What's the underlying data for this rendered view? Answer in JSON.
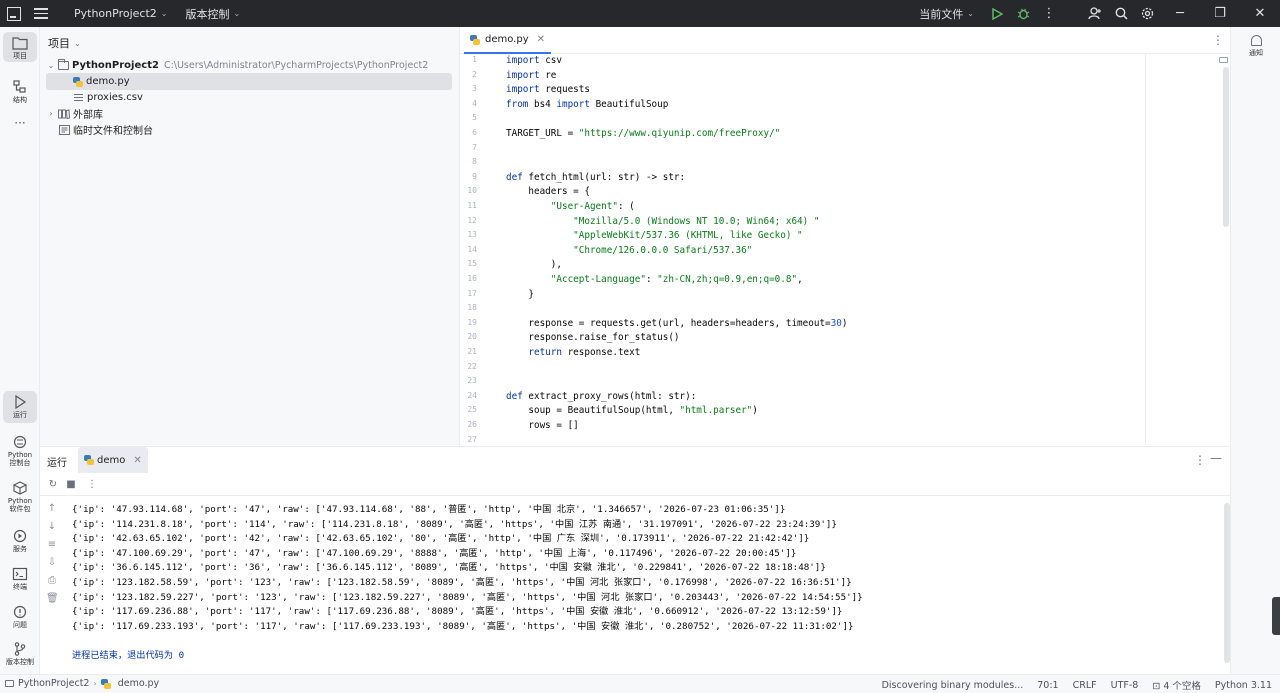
{
  "titlebar": {
    "project": "PythonProject2",
    "vcs": "版本控制",
    "run_config": "当前文件"
  },
  "leftbar": {
    "project_label": "项目",
    "structure_label": "结构",
    "run_label": "运行",
    "python_console_label_1": "Python",
    "python_console_label_2": "控制台",
    "python_packages_label_1": "Python",
    "python_packages_label_2": "软件包",
    "services_label": "服务",
    "terminal_label": "终端",
    "problems_label": "问题",
    "vcs_label": "版本控制"
  },
  "project_panel": {
    "title": "项目",
    "root_name": "PythonProject2",
    "root_path": "C:\\Users\\Administrator\\PycharmProjects\\PythonProject2",
    "file1": "demo.py",
    "file2": "proxies.csv",
    "external_libs": "外部库",
    "scratches": "临时文件和控制台"
  },
  "editor": {
    "tab": "demo.py",
    "lines": [
      "import csv",
      "import re",
      "import requests",
      "from bs4 import BeautifulSoup",
      "",
      "TARGET_URL = \"https://www.qiyunip.com/freeProxy/\"",
      "",
      "",
      "def fetch_html(url: str) -> str:",
      "    headers = {",
      "        \"User-Agent\": (",
      "            \"Mozilla/5.0 (Windows NT 10.0; Win64; x64) \"",
      "            \"AppleWebKit/537.36 (KHTML, like Gecko) \"",
      "            \"Chrome/126.0.0.0 Safari/537.36\"",
      "        ),",
      "        \"Accept-Language\": \"zh-CN,zh;q=0.9,en;q=0.8\",",
      "    }",
      "",
      "    response = requests.get(url, headers=headers, timeout=30)",
      "    response.raise_for_status()",
      "    return response.text",
      "",
      "",
      "def extract_proxy_rows(html: str):",
      "    soup = BeautifulSoup(html, \"html.parser\")",
      "    rows = []",
      ""
    ],
    "line_numbers": [
      "1",
      "2",
      "3",
      "4",
      "5",
      "6",
      "7",
      "8",
      "9",
      "10",
      "11",
      "12",
      "13",
      "14",
      "15",
      "16",
      "17",
      "18",
      "19",
      "20",
      "21",
      "22",
      "23",
      "24",
      "25",
      "26",
      "27"
    ]
  },
  "notifications": {
    "label": "通知"
  },
  "run_panel": {
    "title": "运行",
    "tab": "demo",
    "output": [
      "{'ip': '47.93.114.68', 'port': '47', 'raw': ['47.93.114.68', '88', '普匿', 'http', '中国 北京', '1.346657', '2026-07-23 01:06:35']}",
      "{'ip': '114.231.8.18', 'port': '114', 'raw': ['114.231.8.18', '8089', '高匿', 'https', '中国 江苏 南通', '31.197091', '2026-07-22 23:24:39']}",
      "{'ip': '42.63.65.102', 'port': '42', 'raw': ['42.63.65.102', '80', '高匿', 'http', '中国 广东 深圳', '0.173911', '2026-07-22 21:42:42']}",
      "{'ip': '47.100.69.29', 'port': '47', 'raw': ['47.100.69.29', '8888', '高匿', 'http', '中国 上海', '0.117496', '2026-07-22 20:00:45']}",
      "{'ip': '36.6.145.112', 'port': '36', 'raw': ['36.6.145.112', '8089', '高匿', 'https', '中国 安徽 淮北', '0.229841', '2026-07-22 18:18:48']}",
      "{'ip': '123.182.58.59', 'port': '123', 'raw': ['123.182.58.59', '8089', '高匿', 'https', '中国 河北 张家口', '0.176998', '2026-07-22 16:36:51']}",
      "{'ip': '123.182.59.227', 'port': '123', 'raw': ['123.182.59.227', '8089', '高匿', 'https', '中国 河北 张家口', '0.203443', '2026-07-22 14:54:55']}",
      "{'ip': '117.69.236.88', 'port': '117', 'raw': ['117.69.236.88', '8089', '高匿', 'https', '中国 安徽 淮北', '0.660912', '2026-07-22 13:12:59']}",
      "{'ip': '117.69.233.193', 'port': '117', 'raw': ['117.69.233.193', '8089', '高匿', 'https', '中国 安徽 淮北', '0.280752', '2026-07-22 11:31:02']}"
    ],
    "exit_message": "进程已结束，退出代码为 0"
  },
  "statusbar": {
    "crumb_project": "PythonProject2",
    "crumb_file": "demo.py",
    "task": "Discovering binary modules...",
    "position": "70:1",
    "line_sep": "CRLF",
    "encoding": "UTF-8",
    "indent": "4 个空格",
    "interpreter": "Python 3.11"
  }
}
